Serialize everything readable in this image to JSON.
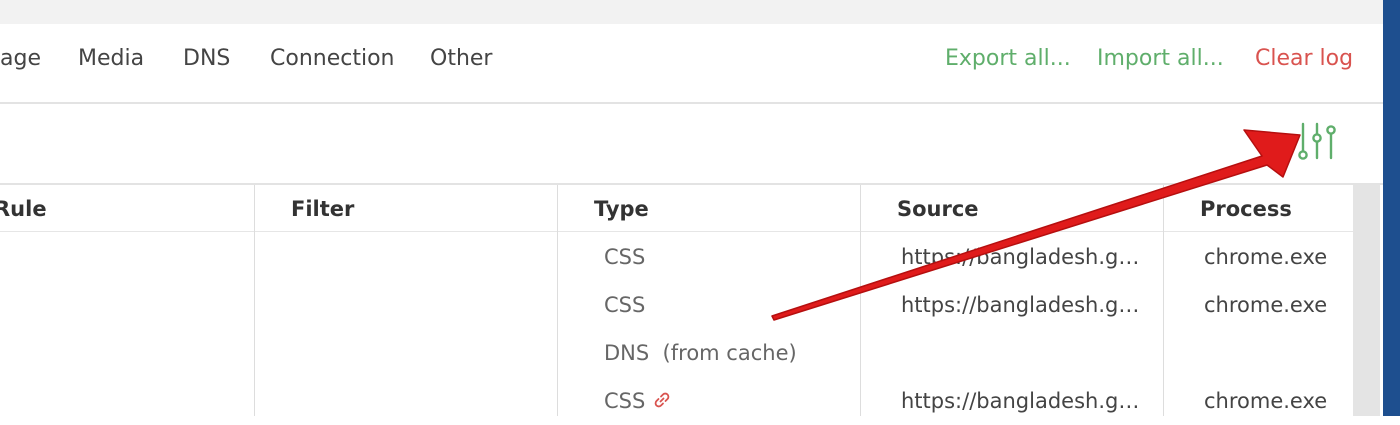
{
  "tabs": [
    "age",
    "Media",
    "DNS",
    "Connection",
    "Other"
  ],
  "actions": {
    "export_label": "Export all...",
    "import_label": "Import all...",
    "clear_label": "Clear log"
  },
  "columns": {
    "rule": "Rule",
    "filter": "Filter",
    "type": "Type",
    "source": "Source",
    "process": "Process"
  },
  "rows": [
    {
      "type": "CSS",
      "source": "https://bangladesh.gov.bd/css",
      "process": "chrome.exe"
    },
    {
      "type": "CSS",
      "source": "https://bangladesh.gov.bd/css",
      "process": "chrome.exe"
    },
    {
      "type": "DNS  (from cache)",
      "source": "",
      "process": ""
    },
    {
      "type": "CSS",
      "source": "https://bangladesh.gov.bd/css",
      "process": "chrome.exe"
    }
  ],
  "icons": {
    "settings": "sliders-icon",
    "row_link": "link-icon",
    "annotation": "red-arrow"
  },
  "colors": {
    "accent_green": "#5fae6b",
    "danger_red": "#d9534f",
    "arrow_red": "#e01b1b"
  }
}
